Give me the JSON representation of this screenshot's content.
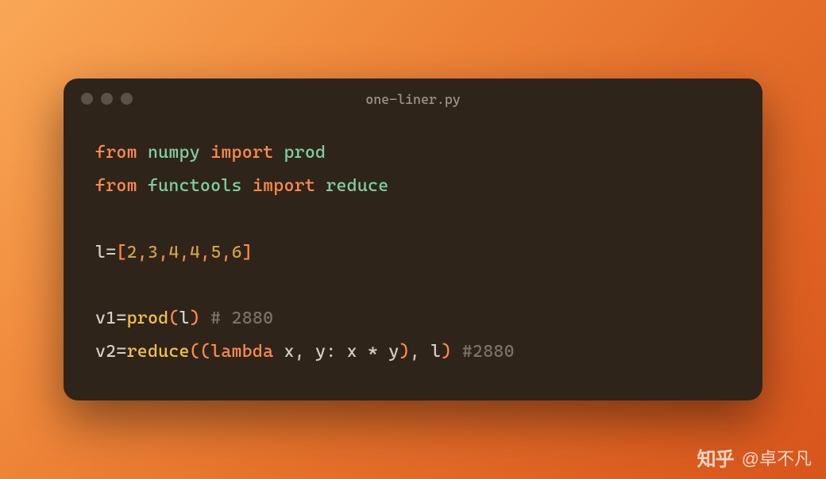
{
  "window": {
    "title": "one-liner.py"
  },
  "code": {
    "l1_from": "from",
    "l1_mod": "numpy",
    "l1_import": "import",
    "l1_name": "prod",
    "l2_from": "from",
    "l2_mod": "functools",
    "l2_import": "import",
    "l2_name": "reduce",
    "l4_var": "l",
    "l4_eq": "=",
    "l4_lb": "[",
    "l4_n1": "2",
    "l4_c": ",",
    "l4_n2": "3",
    "l4_n3": "4",
    "l4_n4": "4",
    "l4_n5": "5",
    "l4_n6": "6",
    "l4_rb": "]",
    "l6_var": "v1",
    "l6_eq": "=",
    "l6_fn": "prod",
    "l6_lp": "(",
    "l6_arg": "l",
    "l6_rp": ")",
    "l6_cmt": "# 2880",
    "l7_var": "v2",
    "l7_eq": "=",
    "l7_fn": "reduce",
    "l7_lp1": "(",
    "l7_lp2": "(",
    "l7_lambda": "lambda",
    "l7_args": " x, y: x ",
    "l7_star": "*",
    "l7_y": " y",
    "l7_rp1": ")",
    "l7_comma": ", ",
    "l7_l": "l",
    "l7_rp2": ")",
    "l7_cmt": "#2880"
  },
  "watermark": {
    "logo": "知乎",
    "author": "@卓不凡"
  }
}
